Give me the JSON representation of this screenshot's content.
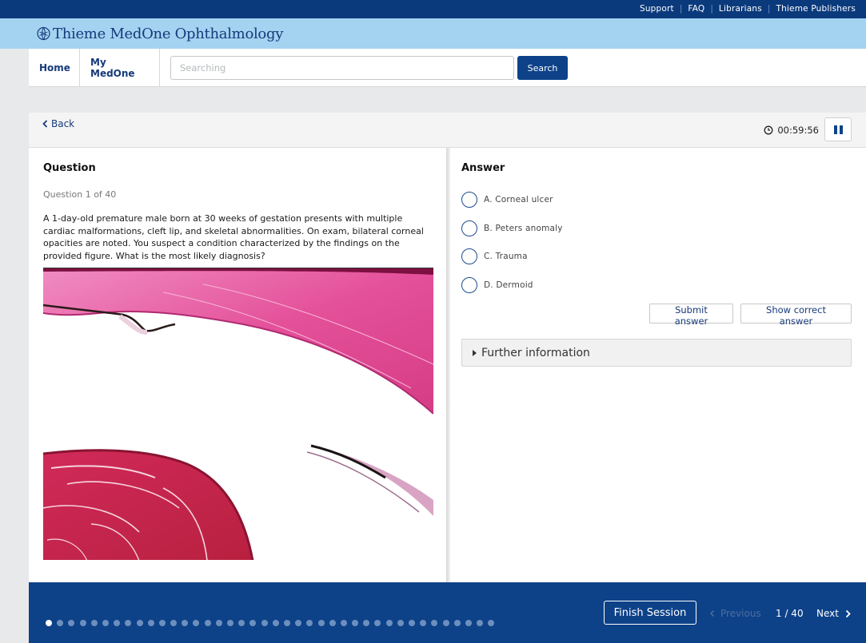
{
  "topbar": {
    "links": [
      "Support",
      "FAQ",
      "Librarians",
      "Thieme Publishers"
    ]
  },
  "brand": {
    "prefix": "Thieme ",
    "name": "MedOne Ophthalmology",
    "logo_icon": "thieme-logo-icon"
  },
  "nav": {
    "home": "Home",
    "my_medone": "My MedOne",
    "search_placeholder": "Searching",
    "search_value": "",
    "search_button": "Search"
  },
  "session": {
    "back_label": "Back",
    "timer": "00:59:56",
    "pause_icon": "pause-icon"
  },
  "question": {
    "heading": "Question",
    "counter": "Question 1 of 40",
    "text": "A 1-day-old premature male born at 30 weeks of gestation presents with multiple cardiac malformations, cleft lip, and skeletal abnormalities. On exam, bilateral corneal opacities are noted. You suspect a condition characterized by the findings on the provided figure. What is the most likely diagnosis?"
  },
  "answer": {
    "heading": "Answer",
    "options": [
      "A. Corneal ulcer",
      "B. Peters anomaly",
      "C. Trauma",
      "D. Dermoid"
    ],
    "selected": null,
    "submit_label": "Submit answer",
    "show_correct_label": "Show correct answer",
    "further_info_label": "Further information"
  },
  "footer": {
    "finish_label": "Finish Session",
    "previous_label": "Previous",
    "pager": "1 / 40",
    "next_label": "Next",
    "total_questions": 40,
    "current_index": 1
  },
  "colors": {
    "navy": "#0d4289",
    "topbar": "#0b3a7c",
    "brand_strip": "#a3d3f1",
    "tissue_pink": "#e7549c",
    "tissue_red": "#c8274f"
  }
}
